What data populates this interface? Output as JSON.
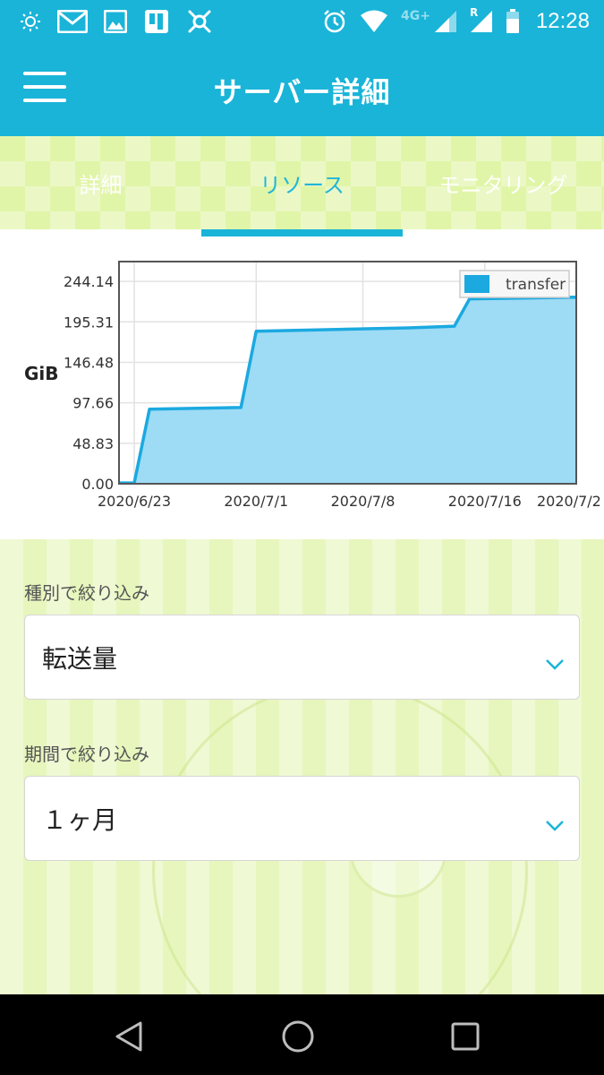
{
  "status_bar": {
    "network_label": "4G+",
    "roaming_label": "R",
    "time": "12:28",
    "icons": [
      "brightness-icon",
      "gmail-icon",
      "gallery-icon",
      "sim-card-icon",
      "app-icon",
      "alarm-icon",
      "wifi-icon",
      "cell-signal-icon",
      "roaming-signal-icon",
      "battery-icon"
    ]
  },
  "app_bar": {
    "title": "サーバー詳細",
    "menu_icon": "hamburger-menu-icon"
  },
  "tabs": [
    {
      "label": "詳細",
      "active": false
    },
    {
      "label": "リソース",
      "active": true
    },
    {
      "label": "モニタリング",
      "active": false
    }
  ],
  "colors": {
    "primary": "#1ab4d8",
    "series_fill": "#9edbf5",
    "series_line": "#1ba9e0",
    "background_green": "#e7f6bd"
  },
  "chart_data": {
    "type": "area",
    "ylabel": "GiB",
    "xlabel": "",
    "y_ticks": [
      "0.00",
      "48.83",
      "97.66",
      "146.48",
      "195.31",
      "244.14"
    ],
    "x_ticks": [
      "2020/6/23",
      "2020/7/1",
      "2020/7/8",
      "2020/7/16",
      "2020/7/2"
    ],
    "ylim": [
      0,
      268
    ],
    "grid": true,
    "legend_position": "top-right",
    "series": [
      {
        "name": "transfer",
        "color": "#1ba9e0",
        "points": [
          {
            "x": "2020/6/22",
            "y": 1
          },
          {
            "x": "2020/6/23",
            "y": 1
          },
          {
            "x": "2020/6/24",
            "y": 90
          },
          {
            "x": "2020/6/30",
            "y": 92
          },
          {
            "x": "2020/7/1",
            "y": 184
          },
          {
            "x": "2020/7/11",
            "y": 188
          },
          {
            "x": "2020/7/14",
            "y": 190
          },
          {
            "x": "2020/7/15",
            "y": 223
          },
          {
            "x": "2020/7/22",
            "y": 225
          }
        ]
      }
    ]
  },
  "filters": {
    "type_label": "種別で絞り込み",
    "type_value": "転送量",
    "period_label": "期間で絞り込み",
    "period_value": "１ヶ月"
  },
  "nav_bar": {
    "icons": [
      "back-icon",
      "home-icon",
      "recent-apps-icon"
    ]
  }
}
